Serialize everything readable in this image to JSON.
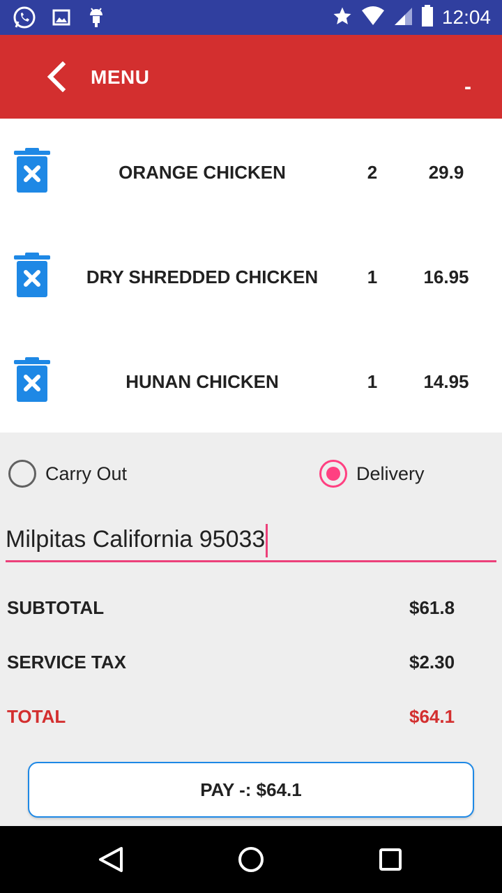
{
  "status_bar": {
    "time": "12:04",
    "left_icons": [
      "whatsapp-icon",
      "image-icon",
      "android-icon"
    ],
    "right_icons": [
      "star-icon",
      "wifi-icon",
      "signal-icon",
      "battery-icon"
    ]
  },
  "toolbar": {
    "title": "MENU",
    "right_text": "-",
    "back_icon": "chevron-left-icon"
  },
  "cart": {
    "items": [
      {
        "name": "ORANGE CHICKEN",
        "qty": "2",
        "price": "29.9"
      },
      {
        "name": "DRY SHREDDED CHICKEN",
        "qty": "1",
        "price": "16.95"
      },
      {
        "name": "HUNAN CHICKEN",
        "qty": "1",
        "price": "14.95"
      }
    ],
    "delete_icon": "trash-delete-icon"
  },
  "order_type": {
    "carry_out": {
      "label": "Carry Out",
      "selected": false
    },
    "delivery": {
      "label": "Delivery",
      "selected": true
    }
  },
  "address": {
    "value": "Milpitas California 95033"
  },
  "totals": {
    "subtotal_label": "SUBTOTAL",
    "subtotal_value": "$61.8",
    "tax_label": "SERVICE TAX",
    "tax_value": "$2.30",
    "total_label": "TOTAL",
    "total_value": "$64.1"
  },
  "pay_button": {
    "label": "PAY -: $64.1"
  },
  "colors": {
    "status_bar": "#303f9f",
    "toolbar": "#d32f2f",
    "accent": "#ff4081",
    "trash_icon": "#1e88e5",
    "total_text": "#d32f2f"
  }
}
